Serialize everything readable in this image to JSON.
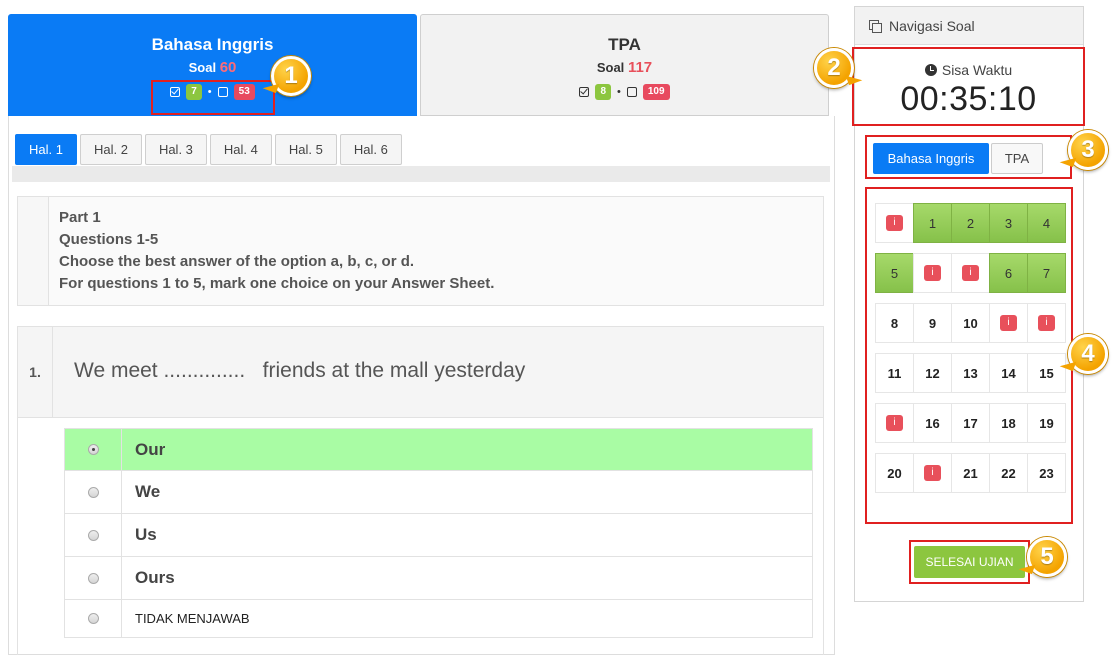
{
  "subjects": [
    {
      "name": "Bahasa Inggris",
      "soal_label": "Soal",
      "soal_count": "60",
      "answered": "7",
      "unanswered": "53",
      "active": true
    },
    {
      "name": "TPA",
      "soal_label": "Soal",
      "soal_count": "117",
      "answered": "8",
      "unanswered": "109",
      "active": false
    }
  ],
  "stat_separator": "•",
  "page_tabs": [
    "Hal. 1",
    "Hal. 2",
    "Hal. 3",
    "Hal. 4",
    "Hal. 5",
    "Hal. 6"
  ],
  "instructions": [
    "Part 1",
    "Questions 1-5",
    "Choose the best answer of the option a, b, c, or d.",
    "For questions 1 to 5, mark one choice on your Answer Sheet."
  ],
  "question": {
    "number": "1.",
    "text": "We meet ..............   friends at the mall yesterday"
  },
  "options": [
    {
      "label": "Our",
      "selected": true
    },
    {
      "label": "We",
      "selected": false
    },
    {
      "label": "Us",
      "selected": false
    },
    {
      "label": "Ours",
      "selected": false
    },
    {
      "label": "TIDAK MENJAWAB",
      "selected": false
    }
  ],
  "sidebar": {
    "title": "Navigasi Soal",
    "timer_label": "Sisa Waktu",
    "timer_value": "00:35:10",
    "tabs": [
      "Bahasa Inggris",
      "TPA"
    ],
    "info_mark": "i",
    "grid_rows": [
      [
        {
          "t": "i",
          "s": "info"
        },
        {
          "t": "1",
          "s": "answered"
        },
        {
          "t": "2",
          "s": "answered"
        },
        {
          "t": "3",
          "s": "answered"
        },
        {
          "t": "4",
          "s": "answered"
        }
      ],
      [
        {
          "t": "5",
          "s": "answered"
        },
        {
          "t": "i",
          "s": "info"
        },
        {
          "t": "i",
          "s": "info"
        },
        {
          "t": "6",
          "s": "answered"
        },
        {
          "t": "7",
          "s": "answered"
        }
      ],
      [
        {
          "t": "8",
          "s": "plain"
        },
        {
          "t": "9",
          "s": "plain"
        },
        {
          "t": "10",
          "s": "plain"
        },
        {
          "t": "i",
          "s": "info"
        },
        {
          "t": "i",
          "s": "info"
        }
      ],
      [
        {
          "t": "11",
          "s": "plain"
        },
        {
          "t": "12",
          "s": "plain"
        },
        {
          "t": "13",
          "s": "plain"
        },
        {
          "t": "14",
          "s": "plain"
        },
        {
          "t": "15",
          "s": "plain"
        }
      ],
      [
        {
          "t": "i",
          "s": "info"
        },
        {
          "t": "16",
          "s": "plain"
        },
        {
          "t": "17",
          "s": "plain"
        },
        {
          "t": "18",
          "s": "plain"
        },
        {
          "t": "19",
          "s": "plain"
        }
      ],
      [
        {
          "t": "20",
          "s": "plain"
        },
        {
          "t": "i",
          "s": "info"
        },
        {
          "t": "21",
          "s": "plain"
        },
        {
          "t": "22",
          "s": "plain"
        },
        {
          "t": "23",
          "s": "plain"
        }
      ]
    ],
    "finish_label": "SELESAI UJIAN"
  },
  "callouts": [
    "1",
    "2",
    "3",
    "4",
    "5"
  ],
  "colors": {
    "primary": "#0a7bf5",
    "answered": "#8cc63f",
    "unanswered": "#e8505b",
    "highlight": "#e02020",
    "selected_option": "#a9fca4",
    "callout": "#f4a300"
  }
}
